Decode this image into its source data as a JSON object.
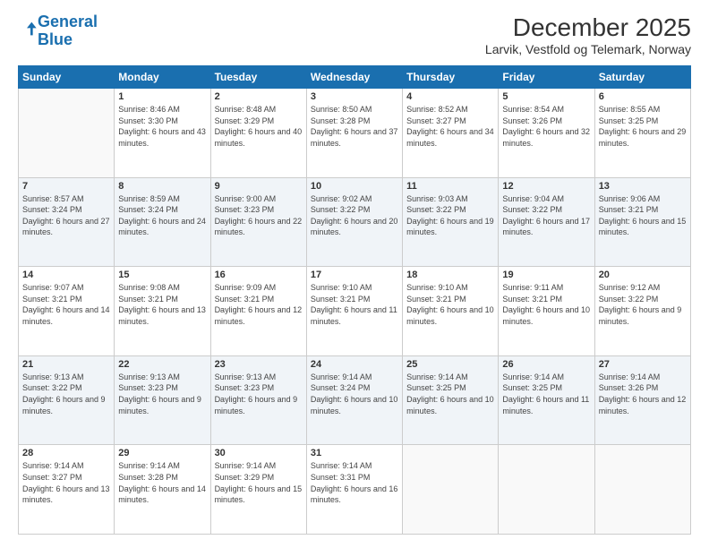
{
  "header": {
    "logo_line1": "General",
    "logo_line2": "Blue",
    "title": "December 2025",
    "subtitle": "Larvik, Vestfold og Telemark, Norway"
  },
  "weekdays": [
    "Sunday",
    "Monday",
    "Tuesday",
    "Wednesday",
    "Thursday",
    "Friday",
    "Saturday"
  ],
  "weeks": [
    [
      {
        "day": "",
        "sunrise": "",
        "sunset": "",
        "daylight": ""
      },
      {
        "day": "1",
        "sunrise": "Sunrise: 8:46 AM",
        "sunset": "Sunset: 3:30 PM",
        "daylight": "Daylight: 6 hours and 43 minutes."
      },
      {
        "day": "2",
        "sunrise": "Sunrise: 8:48 AM",
        "sunset": "Sunset: 3:29 PM",
        "daylight": "Daylight: 6 hours and 40 minutes."
      },
      {
        "day": "3",
        "sunrise": "Sunrise: 8:50 AM",
        "sunset": "Sunset: 3:28 PM",
        "daylight": "Daylight: 6 hours and 37 minutes."
      },
      {
        "day": "4",
        "sunrise": "Sunrise: 8:52 AM",
        "sunset": "Sunset: 3:27 PM",
        "daylight": "Daylight: 6 hours and 34 minutes."
      },
      {
        "day": "5",
        "sunrise": "Sunrise: 8:54 AM",
        "sunset": "Sunset: 3:26 PM",
        "daylight": "Daylight: 6 hours and 32 minutes."
      },
      {
        "day": "6",
        "sunrise": "Sunrise: 8:55 AM",
        "sunset": "Sunset: 3:25 PM",
        "daylight": "Daylight: 6 hours and 29 minutes."
      }
    ],
    [
      {
        "day": "7",
        "sunrise": "Sunrise: 8:57 AM",
        "sunset": "Sunset: 3:24 PM",
        "daylight": "Daylight: 6 hours and 27 minutes."
      },
      {
        "day": "8",
        "sunrise": "Sunrise: 8:59 AM",
        "sunset": "Sunset: 3:24 PM",
        "daylight": "Daylight: 6 hours and 24 minutes."
      },
      {
        "day": "9",
        "sunrise": "Sunrise: 9:00 AM",
        "sunset": "Sunset: 3:23 PM",
        "daylight": "Daylight: 6 hours and 22 minutes."
      },
      {
        "day": "10",
        "sunrise": "Sunrise: 9:02 AM",
        "sunset": "Sunset: 3:22 PM",
        "daylight": "Daylight: 6 hours and 20 minutes."
      },
      {
        "day": "11",
        "sunrise": "Sunrise: 9:03 AM",
        "sunset": "Sunset: 3:22 PM",
        "daylight": "Daylight: 6 hours and 19 minutes."
      },
      {
        "day": "12",
        "sunrise": "Sunrise: 9:04 AM",
        "sunset": "Sunset: 3:22 PM",
        "daylight": "Daylight: 6 hours and 17 minutes."
      },
      {
        "day": "13",
        "sunrise": "Sunrise: 9:06 AM",
        "sunset": "Sunset: 3:21 PM",
        "daylight": "Daylight: 6 hours and 15 minutes."
      }
    ],
    [
      {
        "day": "14",
        "sunrise": "Sunrise: 9:07 AM",
        "sunset": "Sunset: 3:21 PM",
        "daylight": "Daylight: 6 hours and 14 minutes."
      },
      {
        "day": "15",
        "sunrise": "Sunrise: 9:08 AM",
        "sunset": "Sunset: 3:21 PM",
        "daylight": "Daylight: 6 hours and 13 minutes."
      },
      {
        "day": "16",
        "sunrise": "Sunrise: 9:09 AM",
        "sunset": "Sunset: 3:21 PM",
        "daylight": "Daylight: 6 hours and 12 minutes."
      },
      {
        "day": "17",
        "sunrise": "Sunrise: 9:10 AM",
        "sunset": "Sunset: 3:21 PM",
        "daylight": "Daylight: 6 hours and 11 minutes."
      },
      {
        "day": "18",
        "sunrise": "Sunrise: 9:10 AM",
        "sunset": "Sunset: 3:21 PM",
        "daylight": "Daylight: 6 hours and 10 minutes."
      },
      {
        "day": "19",
        "sunrise": "Sunrise: 9:11 AM",
        "sunset": "Sunset: 3:21 PM",
        "daylight": "Daylight: 6 hours and 10 minutes."
      },
      {
        "day": "20",
        "sunrise": "Sunrise: 9:12 AM",
        "sunset": "Sunset: 3:22 PM",
        "daylight": "Daylight: 6 hours and 9 minutes."
      }
    ],
    [
      {
        "day": "21",
        "sunrise": "Sunrise: 9:13 AM",
        "sunset": "Sunset: 3:22 PM",
        "daylight": "Daylight: 6 hours and 9 minutes."
      },
      {
        "day": "22",
        "sunrise": "Sunrise: 9:13 AM",
        "sunset": "Sunset: 3:23 PM",
        "daylight": "Daylight: 6 hours and 9 minutes."
      },
      {
        "day": "23",
        "sunrise": "Sunrise: 9:13 AM",
        "sunset": "Sunset: 3:23 PM",
        "daylight": "Daylight: 6 hours and 9 minutes."
      },
      {
        "day": "24",
        "sunrise": "Sunrise: 9:14 AM",
        "sunset": "Sunset: 3:24 PM",
        "daylight": "Daylight: 6 hours and 10 minutes."
      },
      {
        "day": "25",
        "sunrise": "Sunrise: 9:14 AM",
        "sunset": "Sunset: 3:25 PM",
        "daylight": "Daylight: 6 hours and 10 minutes."
      },
      {
        "day": "26",
        "sunrise": "Sunrise: 9:14 AM",
        "sunset": "Sunset: 3:25 PM",
        "daylight": "Daylight: 6 hours and 11 minutes."
      },
      {
        "day": "27",
        "sunrise": "Sunrise: 9:14 AM",
        "sunset": "Sunset: 3:26 PM",
        "daylight": "Daylight: 6 hours and 12 minutes."
      }
    ],
    [
      {
        "day": "28",
        "sunrise": "Sunrise: 9:14 AM",
        "sunset": "Sunset: 3:27 PM",
        "daylight": "Daylight: 6 hours and 13 minutes."
      },
      {
        "day": "29",
        "sunrise": "Sunrise: 9:14 AM",
        "sunset": "Sunset: 3:28 PM",
        "daylight": "Daylight: 6 hours and 14 minutes."
      },
      {
        "day": "30",
        "sunrise": "Sunrise: 9:14 AM",
        "sunset": "Sunset: 3:29 PM",
        "daylight": "Daylight: 6 hours and 15 minutes."
      },
      {
        "day": "31",
        "sunrise": "Sunrise: 9:14 AM",
        "sunset": "Sunset: 3:31 PM",
        "daylight": "Daylight: 6 hours and 16 minutes."
      },
      {
        "day": "",
        "sunrise": "",
        "sunset": "",
        "daylight": ""
      },
      {
        "day": "",
        "sunrise": "",
        "sunset": "",
        "daylight": ""
      },
      {
        "day": "",
        "sunrise": "",
        "sunset": "",
        "daylight": ""
      }
    ]
  ]
}
